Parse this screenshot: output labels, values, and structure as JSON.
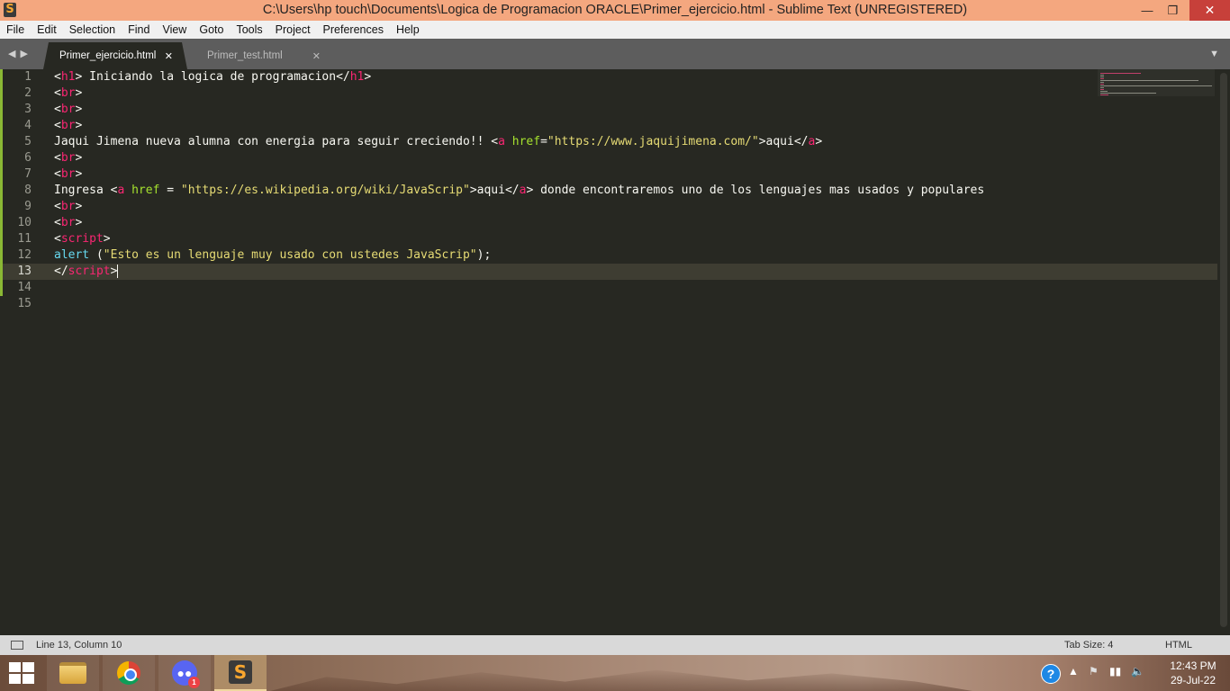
{
  "window": {
    "title": "C:\\Users\\hp touch\\Documents\\Logica de Programacion ORACLE\\Primer_ejercicio.html - Sublime Text (UNREGISTERED)",
    "app_icon": "sublime-icon"
  },
  "menu": [
    "File",
    "Edit",
    "Selection",
    "Find",
    "View",
    "Goto",
    "Tools",
    "Project",
    "Preferences",
    "Help"
  ],
  "tabs": [
    {
      "label": "Primer_ejercicio.html",
      "active": true
    },
    {
      "label": "Primer_test.html",
      "active": false
    }
  ],
  "editor": {
    "line_numbers": [
      "1",
      "2",
      "3",
      "4",
      "5",
      "6",
      "7",
      "8",
      "9",
      "10",
      "11",
      "12",
      "13",
      "14",
      "15"
    ],
    "current_line": 13,
    "lines": [
      [
        [
          "p",
          "<"
        ],
        [
          "t",
          "h1"
        ],
        [
          "p",
          "> Iniciando la logica de programacion</"
        ],
        [
          "t",
          "h1"
        ],
        [
          "p",
          ">"
        ]
      ],
      [
        [
          "p",
          "<"
        ],
        [
          "t",
          "br"
        ],
        [
          "p",
          ">"
        ]
      ],
      [
        [
          "p",
          "<"
        ],
        [
          "t",
          "br"
        ],
        [
          "p",
          ">"
        ]
      ],
      [
        [
          "p",
          "<"
        ],
        [
          "t",
          "br"
        ],
        [
          "p",
          ">"
        ]
      ],
      [
        [
          "p",
          "Jaqui Jimena nueva alumna con energia para seguir creciendo!! <"
        ],
        [
          "t",
          "a"
        ],
        [
          "p",
          " "
        ],
        [
          "a",
          "href"
        ],
        [
          "p",
          "="
        ],
        [
          "s",
          "\"https://www.jaquijimena.com/\""
        ],
        [
          "p",
          ">aqui</"
        ],
        [
          "t",
          "a"
        ],
        [
          "p",
          ">"
        ]
      ],
      [
        [
          "p",
          "<"
        ],
        [
          "t",
          "br"
        ],
        [
          "p",
          ">"
        ]
      ],
      [
        [
          "p",
          "<"
        ],
        [
          "t",
          "br"
        ],
        [
          "p",
          ">"
        ]
      ],
      [
        [
          "p",
          "Ingresa <"
        ],
        [
          "t",
          "a"
        ],
        [
          "p",
          " "
        ],
        [
          "a",
          "href"
        ],
        [
          "p",
          " = "
        ],
        [
          "s",
          "\"https://es.wikipedia.org/wiki/JavaScrip\""
        ],
        [
          "p",
          ">aqui</"
        ],
        [
          "t",
          "a"
        ],
        [
          "p",
          "> donde encontraremos uno de los lenguajes mas usados y populares"
        ]
      ],
      [
        [
          "p",
          "<"
        ],
        [
          "t",
          "br"
        ],
        [
          "p",
          ">"
        ]
      ],
      [
        [
          "p",
          "<"
        ],
        [
          "t",
          "br"
        ],
        [
          "p",
          ">"
        ]
      ],
      [
        [
          "p",
          "<"
        ],
        [
          "t",
          "script"
        ],
        [
          "p",
          ">"
        ]
      ],
      [
        [
          "f",
          "alert"
        ],
        [
          "p",
          " ("
        ],
        [
          "s",
          "\"Esto es un lenguaje muy usado con ustedes JavaScrip\""
        ],
        [
          "p",
          ");"
        ]
      ],
      [
        [
          "p",
          "</"
        ],
        [
          "t",
          "script"
        ],
        [
          "p",
          ">"
        ]
      ],
      [],
      []
    ]
  },
  "status": {
    "position": "Line 13, Column 10",
    "tab_size": "Tab Size: 4",
    "syntax": "HTML"
  },
  "taskbar": {
    "apps": [
      "file-explorer-icon",
      "chrome-icon",
      "discord-icon",
      "sublime-icon"
    ],
    "discord_badge": "1",
    "clock_time": "12:43 PM",
    "clock_date": "29-Jul-22"
  }
}
